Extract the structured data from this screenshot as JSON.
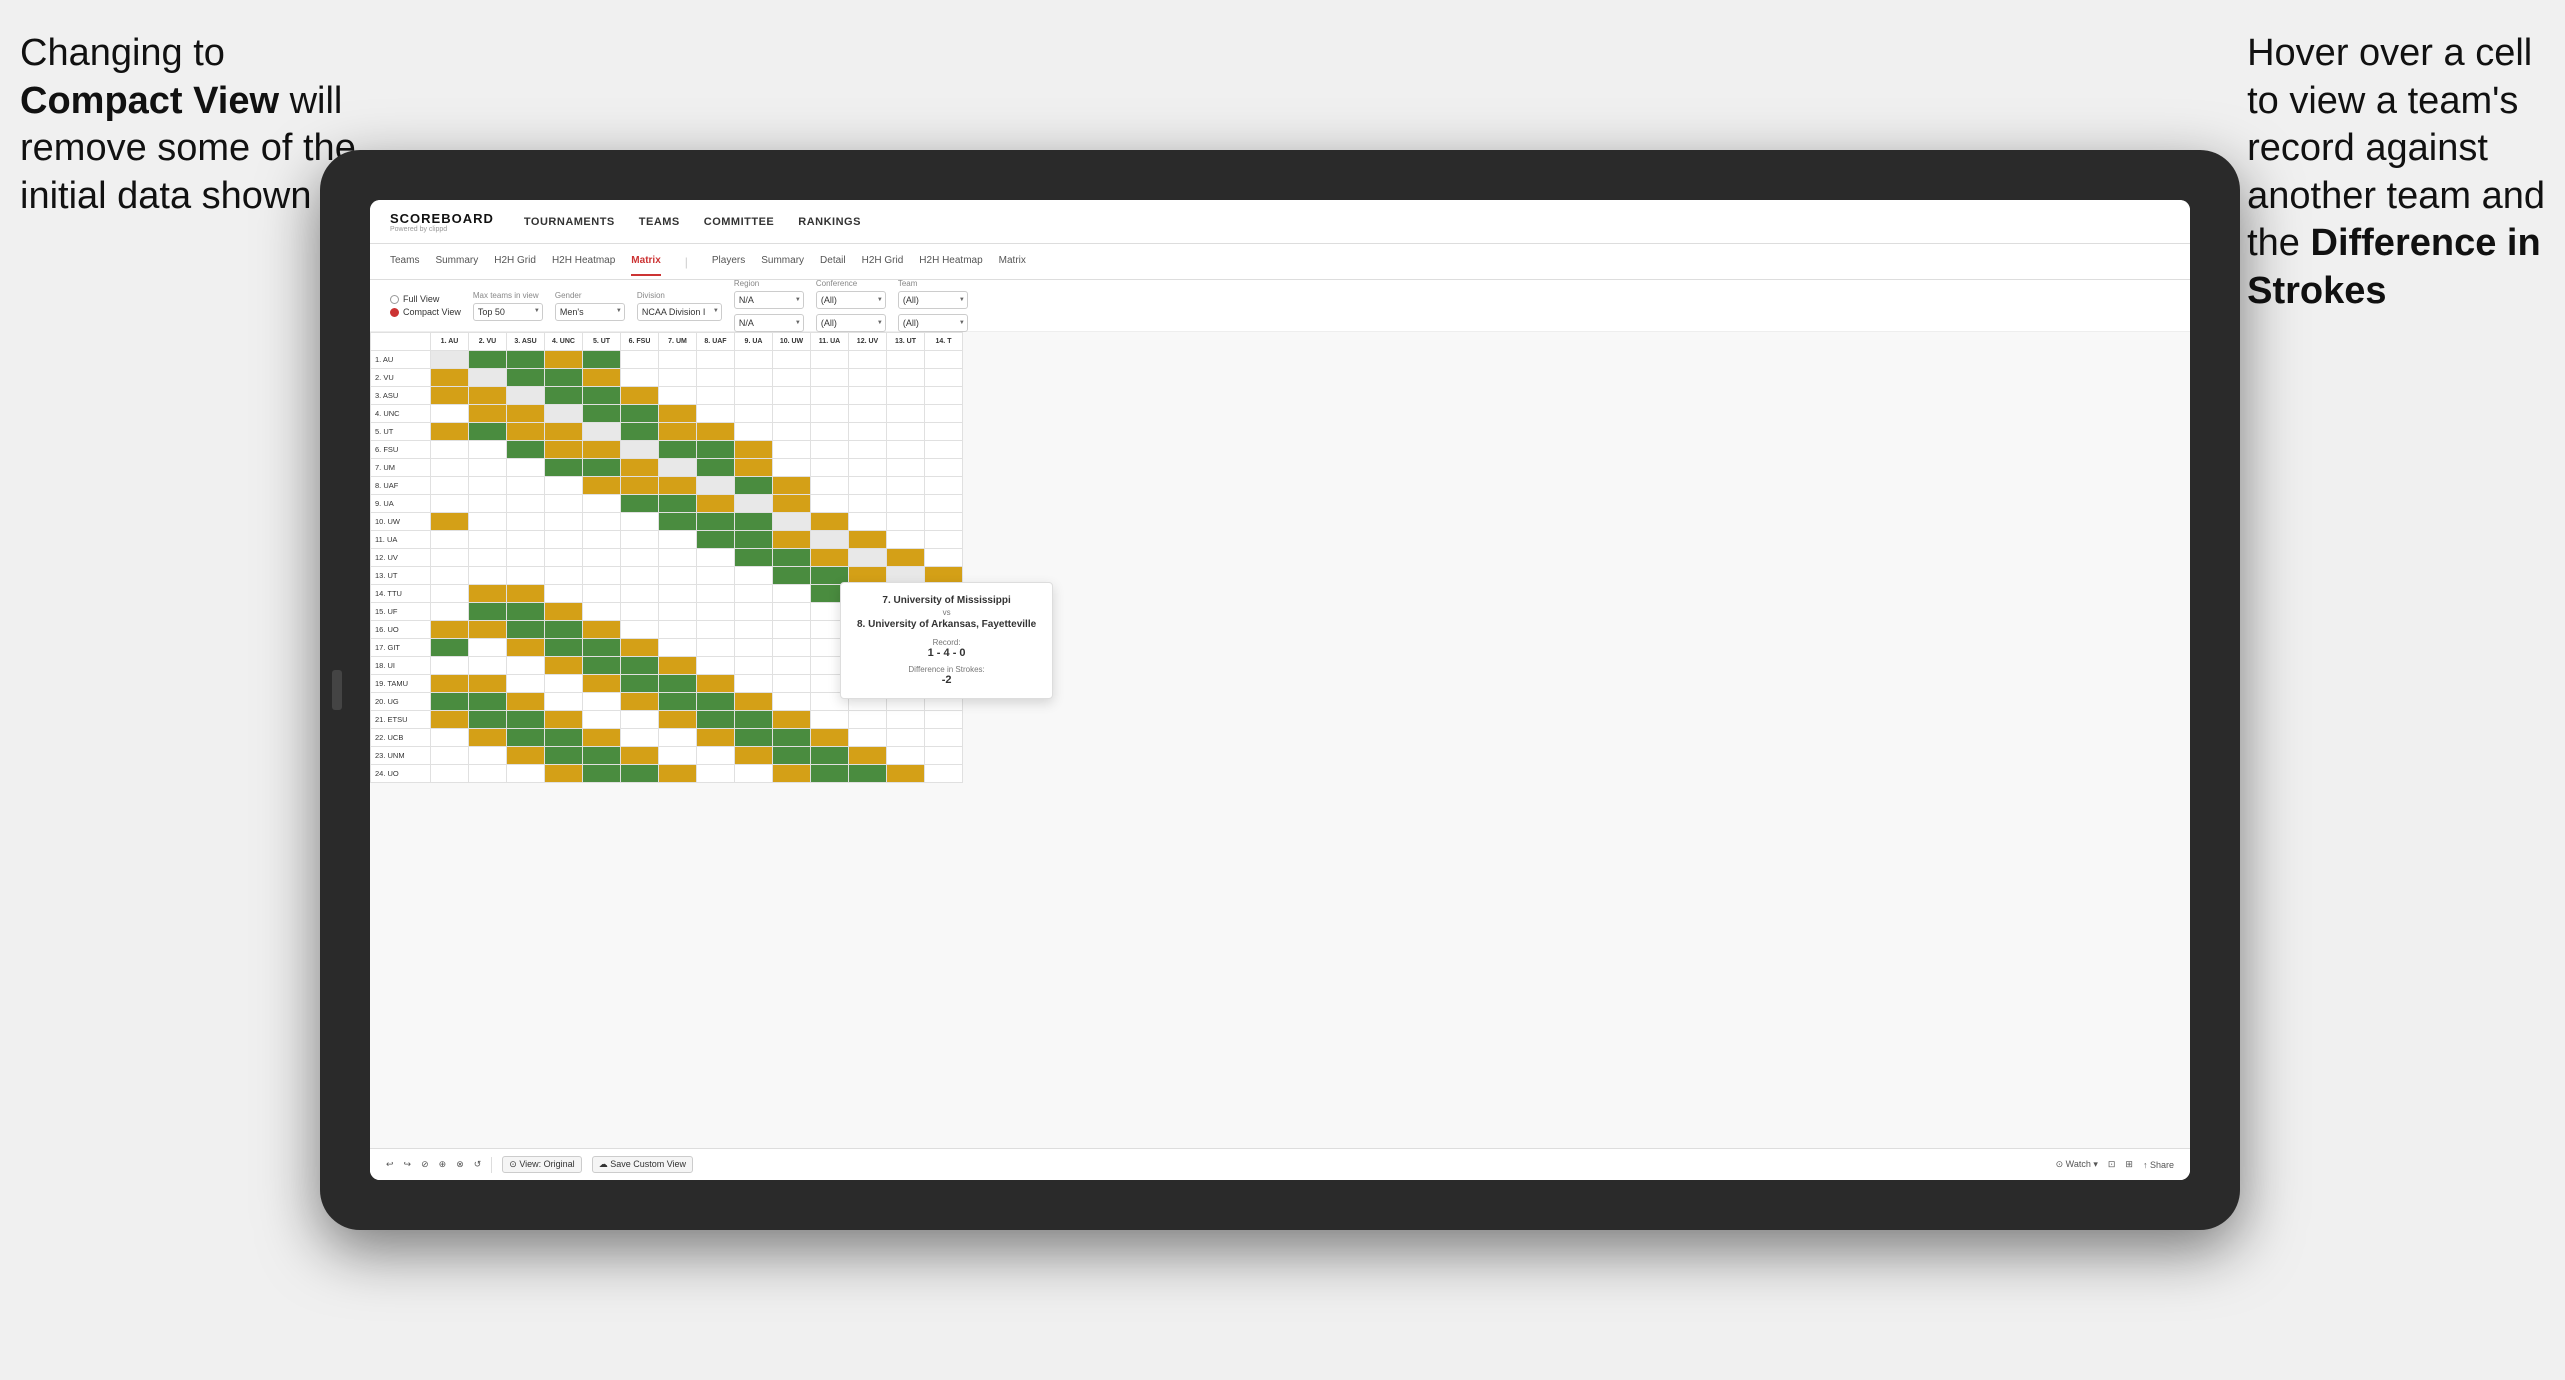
{
  "annotation_left": {
    "line1": "Changing to",
    "line2_bold": "Compact View",
    "line2_rest": " will",
    "line3": "remove some of the",
    "line4": "initial data shown"
  },
  "annotation_right": {
    "line1": "Hover over a cell",
    "line2": "to view a team's",
    "line3": "record against",
    "line4": "another team and",
    "line5": "the ",
    "line5_bold": "Difference in",
    "line6_bold": "Strokes"
  },
  "nav": {
    "logo": "SCOREBOARD",
    "logo_sub": "Powered by clippd",
    "items": [
      "TOURNAMENTS",
      "TEAMS",
      "COMMITTEE",
      "RANKINGS"
    ]
  },
  "sub_nav": {
    "groups": [
      {
        "items": [
          "Teams",
          "Summary",
          "H2H Grid",
          "H2H Heatmap",
          "Matrix"
        ]
      },
      {
        "items": [
          "Players",
          "Summary",
          "Detail",
          "H2H Grid",
          "H2H Heatmap",
          "Matrix"
        ]
      }
    ],
    "active": "Matrix"
  },
  "filters": {
    "view_options": [
      "Full View",
      "Compact View"
    ],
    "selected_view": "Compact View",
    "max_teams": {
      "label": "Max teams in view",
      "value": "Top 50"
    },
    "gender": {
      "label": "Gender",
      "value": "Men's"
    },
    "division": {
      "label": "Division",
      "value": "NCAA Division I"
    },
    "region": {
      "label": "Region",
      "value": "N/A"
    },
    "conference": {
      "label": "Conference",
      "value": "(All)"
    },
    "team": {
      "label": "Team",
      "value": "(All)"
    }
  },
  "col_headers": [
    "1. AU",
    "2. VU",
    "3. ASU",
    "4. UNC",
    "5. UT",
    "6. FSU",
    "7. UM",
    "8. UAF",
    "9. UA",
    "10. UW",
    "11. UA",
    "12. UV",
    "13. UT",
    "14. T"
  ],
  "row_teams": [
    "1. AU",
    "2. VU",
    "3. ASU",
    "4. UNC",
    "5. UT",
    "6. FSU",
    "7. UM",
    "8. UAF",
    "9. UA",
    "10. UW",
    "11. UA",
    "12. UV",
    "13. UT",
    "14. TTU",
    "15. UF",
    "16. UO",
    "17. GIT",
    "18. UI",
    "19. TAMU",
    "20. UG",
    "21. ETSU",
    "22. UCB",
    "23. UNM",
    "24. UO"
  ],
  "tooltip": {
    "team1": "7. University of Mississippi",
    "vs": "vs",
    "team2": "8. University of Arkansas, Fayetteville",
    "record_label": "Record:",
    "record_value": "1 - 4 - 0",
    "diff_label": "Difference in Strokes:",
    "diff_value": "-2"
  },
  "toolbar": {
    "undo": "↩",
    "redo": "↪",
    "view_original": "View: Original",
    "save_custom": "Save Custom View",
    "watch": "Watch",
    "share": "Share"
  }
}
